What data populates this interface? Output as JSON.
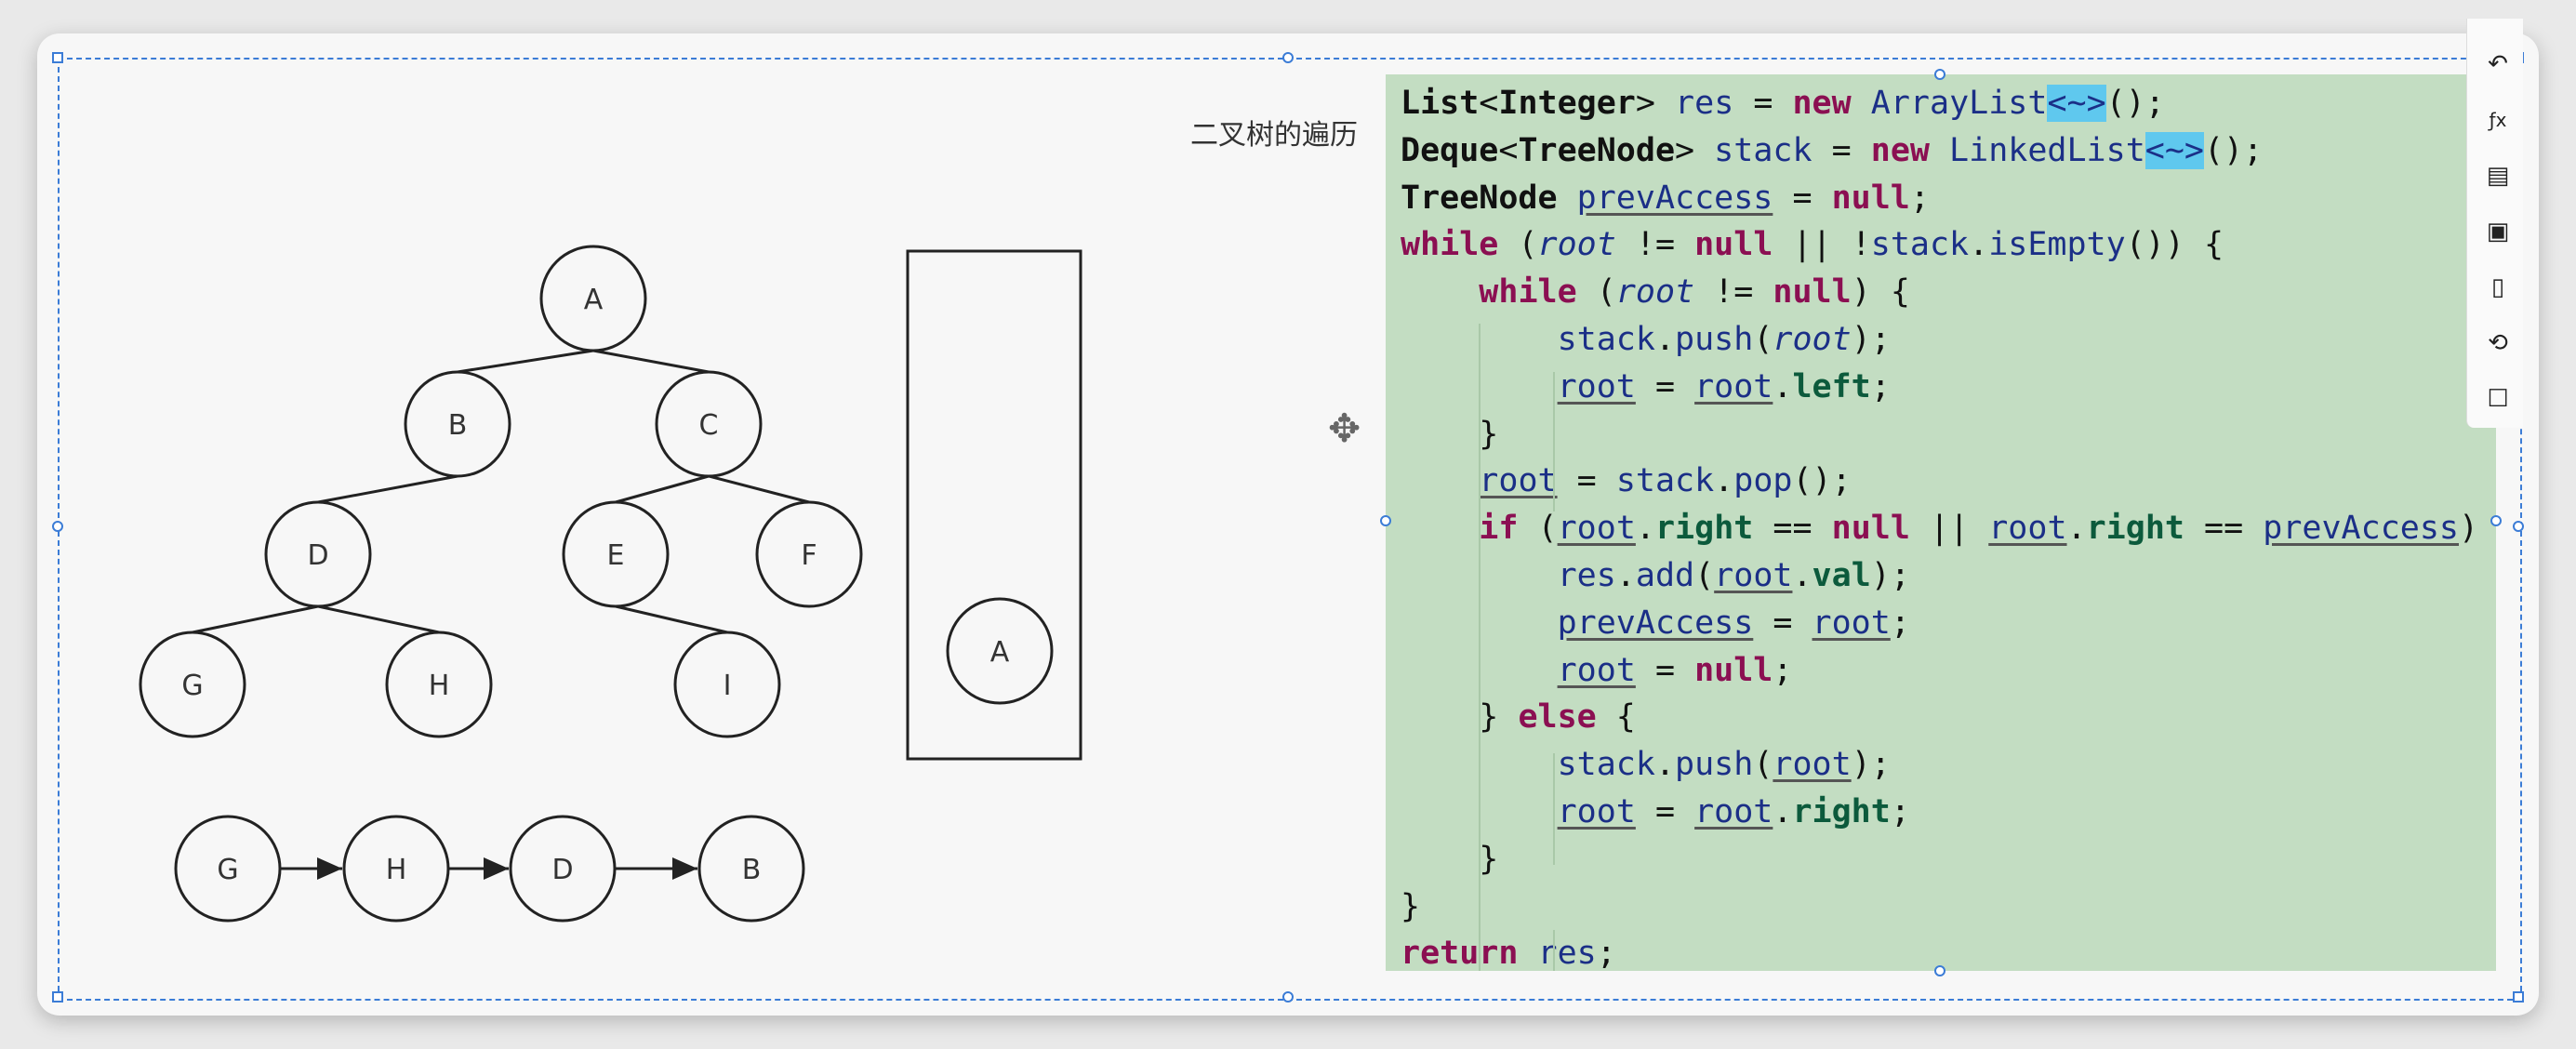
{
  "title": "二叉树的遍历",
  "tree": {
    "nodes": [
      "A",
      "B",
      "C",
      "D",
      "E",
      "F",
      "G",
      "H",
      "I"
    ],
    "edges": [
      [
        "A",
        "B"
      ],
      [
        "A",
        "C"
      ],
      [
        "B",
        "D"
      ],
      [
        "C",
        "E"
      ],
      [
        "C",
        "F"
      ],
      [
        "D",
        "G"
      ],
      [
        "D",
        "H"
      ],
      [
        "E",
        "I"
      ]
    ]
  },
  "stack": [
    "A"
  ],
  "output_sequence": [
    "G",
    "H",
    "D",
    "B"
  ],
  "code": [
    [
      [
        "ty",
        "List"
      ],
      [
        "pn",
        "<"
      ],
      [
        "ty",
        "Integer"
      ],
      [
        "pn",
        "> "
      ],
      [
        "id",
        "res"
      ],
      [
        "pn",
        " = "
      ],
      [
        "kw",
        "new"
      ],
      [
        "pn",
        " "
      ],
      [
        "id",
        "ArrayList"
      ],
      [
        "dia",
        "<~>"
      ],
      [
        "pn",
        "();"
      ]
    ],
    [
      [
        "ty",
        "Deque"
      ],
      [
        "pn",
        "<"
      ],
      [
        "ty",
        "TreeNode"
      ],
      [
        "pn",
        "> "
      ],
      [
        "id",
        "stack"
      ],
      [
        "pn",
        " = "
      ],
      [
        "kw",
        "new"
      ],
      [
        "pn",
        " "
      ],
      [
        "id",
        "LinkedList"
      ],
      [
        "dia",
        "<~>"
      ],
      [
        "pn",
        "();"
      ]
    ],
    [
      [
        "ty",
        "TreeNode"
      ],
      [
        "pn",
        " "
      ],
      [
        "idu",
        "prevAccess"
      ],
      [
        "pn",
        " = "
      ],
      [
        "kw",
        "null"
      ],
      [
        "pn",
        ";"
      ]
    ],
    [
      [
        "kw",
        "while"
      ],
      [
        "pn",
        " ("
      ],
      [
        "it",
        "root"
      ],
      [
        "pn",
        " != "
      ],
      [
        "kw",
        "null"
      ],
      [
        "pn",
        " || !"
      ],
      [
        "fn",
        "stack"
      ],
      [
        "pn",
        "."
      ],
      [
        "fn",
        "isEmpty"
      ],
      [
        "pn",
        "()) {"
      ]
    ],
    [
      [
        "pn",
        "    "
      ],
      [
        "kw",
        "while"
      ],
      [
        "pn",
        " ("
      ],
      [
        "it",
        "root"
      ],
      [
        "pn",
        " != "
      ],
      [
        "kw",
        "null"
      ],
      [
        "pn",
        ") {"
      ]
    ],
    [
      [
        "pn",
        "        "
      ],
      [
        "fn",
        "stack"
      ],
      [
        "pn",
        "."
      ],
      [
        "fn",
        "push"
      ],
      [
        "pn",
        "("
      ],
      [
        "it",
        "root"
      ],
      [
        "pn",
        ");"
      ]
    ],
    [
      [
        "pn",
        "        "
      ],
      [
        "idu",
        "root"
      ],
      [
        "pn",
        " = "
      ],
      [
        "idu",
        "root"
      ],
      [
        "pn",
        "."
      ],
      [
        "pr",
        "left"
      ],
      [
        "pn",
        ";"
      ]
    ],
    [
      [
        "pn",
        "    }"
      ]
    ],
    [
      [
        "pn",
        "    "
      ],
      [
        "idu",
        "root"
      ],
      [
        "pn",
        " = "
      ],
      [
        "fn",
        "stack"
      ],
      [
        "pn",
        "."
      ],
      [
        "fn",
        "pop"
      ],
      [
        "pn",
        "();"
      ]
    ],
    [
      [
        "pn",
        "    "
      ],
      [
        "kw",
        "if"
      ],
      [
        "pn",
        " ("
      ],
      [
        "idu",
        "root"
      ],
      [
        "pn",
        "."
      ],
      [
        "pr",
        "right"
      ],
      [
        "pn",
        " == "
      ],
      [
        "kw",
        "null"
      ],
      [
        "pn",
        " || "
      ],
      [
        "idu",
        "root"
      ],
      [
        "pn",
        "."
      ],
      [
        "pr",
        "right"
      ],
      [
        "pn",
        " == "
      ],
      [
        "idu",
        "prevAccess"
      ],
      [
        "pn",
        ") {"
      ]
    ],
    [
      [
        "pn",
        "        "
      ],
      [
        "fn",
        "res"
      ],
      [
        "pn",
        "."
      ],
      [
        "fn",
        "add"
      ],
      [
        "pn",
        "("
      ],
      [
        "idu",
        "root"
      ],
      [
        "pn",
        "."
      ],
      [
        "pr",
        "val"
      ],
      [
        "pn",
        ");"
      ]
    ],
    [
      [
        "pn",
        "        "
      ],
      [
        "idu",
        "prevAccess"
      ],
      [
        "pn",
        " = "
      ],
      [
        "idu",
        "root"
      ],
      [
        "pn",
        ";"
      ]
    ],
    [
      [
        "pn",
        "        "
      ],
      [
        "idu",
        "root"
      ],
      [
        "pn",
        " = "
      ],
      [
        "kw",
        "null"
      ],
      [
        "pn",
        ";"
      ]
    ],
    [
      [
        "pn",
        "    } "
      ],
      [
        "kw",
        "else"
      ],
      [
        "pn",
        " {"
      ]
    ],
    [
      [
        "pn",
        "        "
      ],
      [
        "fn",
        "stack"
      ],
      [
        "pn",
        "."
      ],
      [
        "fn",
        "push"
      ],
      [
        "pn",
        "("
      ],
      [
        "idu",
        "root"
      ],
      [
        "pn",
        ");"
      ]
    ],
    [
      [
        "pn",
        "        "
      ],
      [
        "idu",
        "root"
      ],
      [
        "pn",
        " = "
      ],
      [
        "idu",
        "root"
      ],
      [
        "pn",
        "."
      ],
      [
        "pr",
        "right"
      ],
      [
        "pn",
        ";"
      ]
    ],
    [
      [
        "pn",
        "    }"
      ]
    ],
    [
      [
        "pn",
        "}"
      ]
    ],
    [
      [
        "kw",
        "return"
      ],
      [
        "pn",
        " "
      ],
      [
        "fn",
        "res"
      ],
      [
        "pn",
        ";"
      ]
    ]
  ],
  "toolbar_icons": [
    "undo-icon",
    "formula-icon",
    "calendar-icon",
    "panel-icon",
    "page-icon",
    "history-icon",
    "comment-icon"
  ],
  "colors": {
    "code_background": "#c3ddc2",
    "keyword": "#8b0f52",
    "identifier": "#1b2f87",
    "diamond_highlight": "#5fc8ee",
    "selection_frame": "#3b7cd6"
  }
}
